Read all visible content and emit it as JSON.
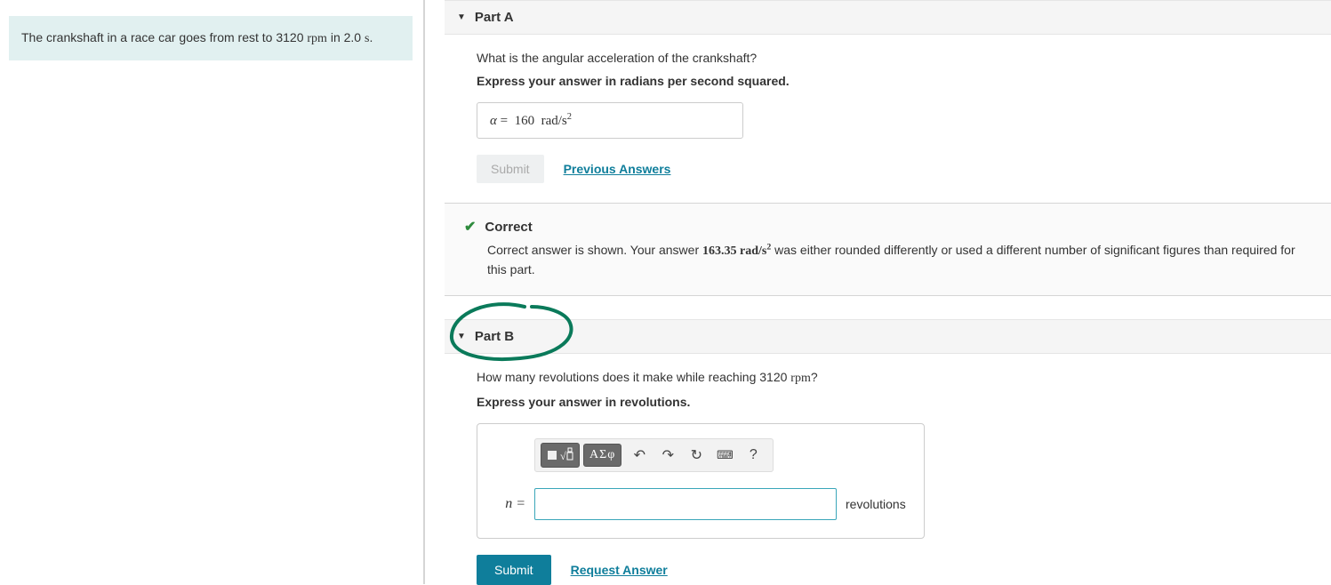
{
  "problem": {
    "text_prefix": "The crankshaft in a race car goes from rest to 3120 ",
    "rpm_unit": "rpm",
    "text_mid": " in 2.0 ",
    "s_unit": "s",
    "text_suffix": "."
  },
  "partA": {
    "label": "Part A",
    "question": "What is the angular acceleration of the crankshaft?",
    "instruction": "Express your answer in radians per second squared.",
    "answer_var": "α",
    "answer_eq": "=",
    "answer_val": "160",
    "answer_unit_rad": "rad",
    "answer_unit_slash": "/",
    "answer_unit_s": "s",
    "submit": "Submit",
    "prev_answers": "Previous Answers",
    "feedback": {
      "correct": "Correct",
      "text_pre": "Correct answer is shown. Your answer ",
      "your_answer": "163.35",
      "unit_rad": "rad",
      "unit_slash": "/",
      "unit_s": "s",
      "text_post": " was either rounded differently or used a different number of significant figures than required for this part."
    }
  },
  "partB": {
    "label": "Part B",
    "question_pre": "How many revolutions does it make while reaching 3120 ",
    "rpm_unit": "rpm",
    "question_post": "?",
    "instruction": "Express your answer in revolutions.",
    "toolbar": {
      "greek": "ΑΣφ",
      "undo": "↶",
      "redo": "↷",
      "reset": "↻",
      "keyboard": "⌨",
      "help": "?"
    },
    "var_label": "n =",
    "units": "revolutions",
    "submit": "Submit",
    "request": "Request Answer"
  }
}
